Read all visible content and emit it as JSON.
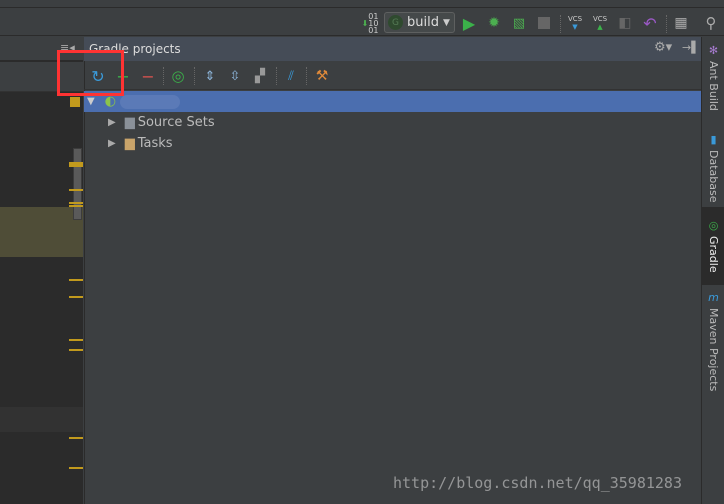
{
  "toolbar": {
    "run_config": "build",
    "run_config_badge": "G",
    "vcs_update": "VCS",
    "vcs_commit": "VCS"
  },
  "panel": {
    "title": "Gradle projects"
  },
  "tree": {
    "root_label": "",
    "items": [
      {
        "label": "Source Sets"
      },
      {
        "label": "Tasks"
      }
    ]
  },
  "right_tabs": [
    {
      "label": "Ant Build"
    },
    {
      "label": "Database"
    },
    {
      "label": "Gradle"
    },
    {
      "label": "Maven Projects"
    }
  ],
  "watermark": "http://blog.csdn.net/qq_35981283",
  "colors": {
    "selection": "#4b6eaf",
    "highlight_box": "#ff3333",
    "marker": "#c29a1d"
  }
}
